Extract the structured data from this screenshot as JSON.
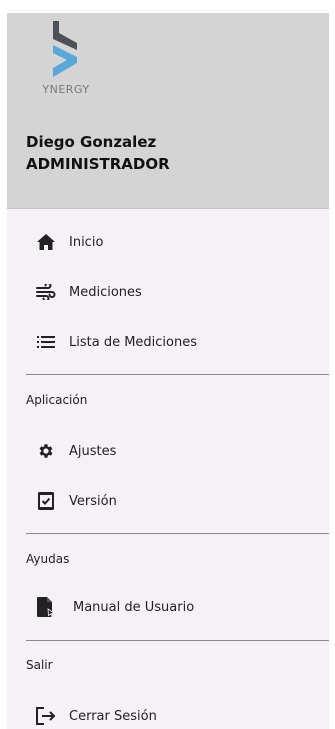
{
  "header": {
    "logo_text": "YNERGY",
    "user_name": "Diego Gonzalez",
    "user_role": "ADMINISTRADOR",
    "logo_colors": {
      "dark": "#4d5057",
      "light": "#5aa7db"
    }
  },
  "menu": {
    "main": [
      {
        "label": "Inicio",
        "icon": "home-icon"
      },
      {
        "label": "Mediciones",
        "icon": "wind-icon"
      },
      {
        "label": "Lista de Mediciones",
        "icon": "list-icon"
      }
    ],
    "sections": [
      {
        "title": "Aplicación",
        "items": [
          {
            "label": "Ajustes",
            "icon": "gear-icon"
          },
          {
            "label": "Versión",
            "icon": "checkbox-icon"
          }
        ]
      },
      {
        "title": "Ayudas",
        "items": [
          {
            "label": "Manual de Usuario",
            "icon": "document-icon"
          }
        ]
      },
      {
        "title": "Salir",
        "items": [
          {
            "label": "Cerrar Sesión",
            "icon": "logout-icon"
          }
        ]
      }
    ]
  }
}
